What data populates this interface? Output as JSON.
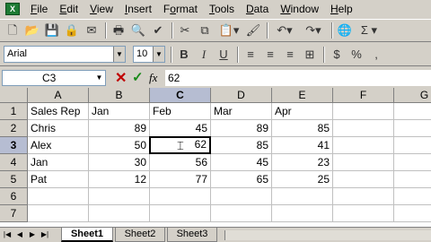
{
  "app": {
    "icon_label": "X"
  },
  "menu": [
    {
      "label": "File",
      "ul": "F",
      "rest": "ile"
    },
    {
      "label": "Edit",
      "ul": "E",
      "rest": "dit"
    },
    {
      "label": "View",
      "ul": "V",
      "rest": "iew"
    },
    {
      "label": "Insert",
      "ul": "I",
      "rest": "nsert"
    },
    {
      "label": "Format",
      "ul": "o",
      "pre": "F",
      "rest": "rmat"
    },
    {
      "label": "Tools",
      "ul": "T",
      "rest": "ools"
    },
    {
      "label": "Data",
      "ul": "D",
      "rest": "ata"
    },
    {
      "label": "Window",
      "ul": "W",
      "rest": "indow"
    },
    {
      "label": "Help",
      "ul": "H",
      "rest": "elp"
    }
  ],
  "format_bar": {
    "font": "Arial",
    "size": "10"
  },
  "formula_bar": {
    "cell_ref": "C3",
    "value": "62",
    "fx": "fx"
  },
  "columns": [
    "A",
    "B",
    "C",
    "D",
    "E",
    "F",
    "G"
  ],
  "rows": [
    "1",
    "2",
    "3",
    "4",
    "5",
    "6",
    "7"
  ],
  "selected_cell": "C3",
  "cells": [
    [
      "Sales Rep",
      "Jan",
      "Feb",
      "Mar",
      "Apr",
      "",
      ""
    ],
    [
      "Chris",
      "89",
      "45",
      "89",
      "85",
      "",
      ""
    ],
    [
      "Alex",
      "50",
      "62",
      "85",
      "41",
      "",
      ""
    ],
    [
      "Jan",
      "30",
      "56",
      "45",
      "23",
      "",
      ""
    ],
    [
      "Pat",
      "12",
      "77",
      "65",
      "25",
      "",
      ""
    ],
    [
      "",
      "",
      "",
      "",
      "",
      "",
      ""
    ],
    [
      "",
      "",
      "",
      "",
      "",
      "",
      ""
    ]
  ],
  "sheets": [
    "Sheet1",
    "Sheet2",
    "Sheet3"
  ],
  "active_sheet": "Sheet1"
}
